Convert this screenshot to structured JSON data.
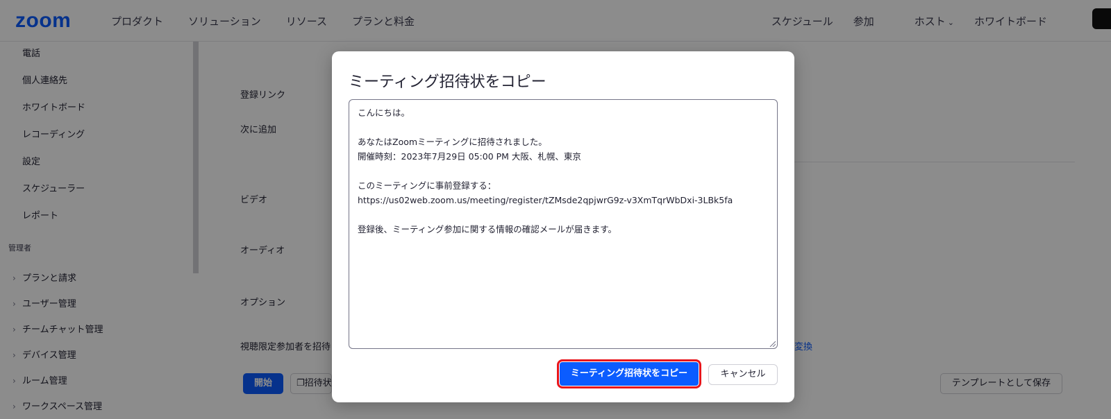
{
  "nav": {
    "logo": "zoom",
    "left": [
      "プロダクト",
      "ソリューション",
      "リソース",
      "プランと料金"
    ],
    "right": {
      "schedule": "スケジュール",
      "join": "参加",
      "host": "ホスト",
      "whiteboard": "ホワイトボード"
    }
  },
  "sidebar": {
    "items": [
      "電話",
      "個人連絡先",
      "ホワイトボード",
      "レコーディング",
      "設定",
      "スケジューラー",
      "レポート"
    ],
    "admin_section": "管理者",
    "admin_items": [
      "プランと請求",
      "ユーザー管理",
      "チームチャット管理",
      "デバイス管理",
      "ルーム管理",
      "ワークスペース管理"
    ]
  },
  "form": {
    "registration_link": "登録リンク",
    "add_to": "次に追加",
    "video": "ビデオ",
    "audio": "オーディオ",
    "options": "オプション",
    "invite_viewers": "視聴限定参加者を招待",
    "convert_link": "ーに変換",
    "start_button": "開始",
    "invite_button": "招待状",
    "save_template_button": "テンプレートとして保存"
  },
  "modal": {
    "title": "ミーティング招待状をコピー",
    "invitation_lines": [
      "こんにちは。",
      "",
      "あなたはZoomミーティングに招待されました。",
      "開催時刻：2023年7月29日 05:00 PM 大阪、札幌、東京",
      "",
      "このミーティングに事前登録する：",
      "https://us02web.zoom.us/meeting/register/tZMsde2qpjwrG9z-v3XmTqrWbDxi-3LBk5fa",
      "",
      "登録後、ミーティング参加に関する情報の確認メールが届きます。"
    ],
    "copy_button": "ミーティング招待状をコピー",
    "cancel_button": "キャンセル"
  },
  "colors": {
    "brand_blue": "#0b5cff",
    "highlight_red": "#e8151b"
  }
}
